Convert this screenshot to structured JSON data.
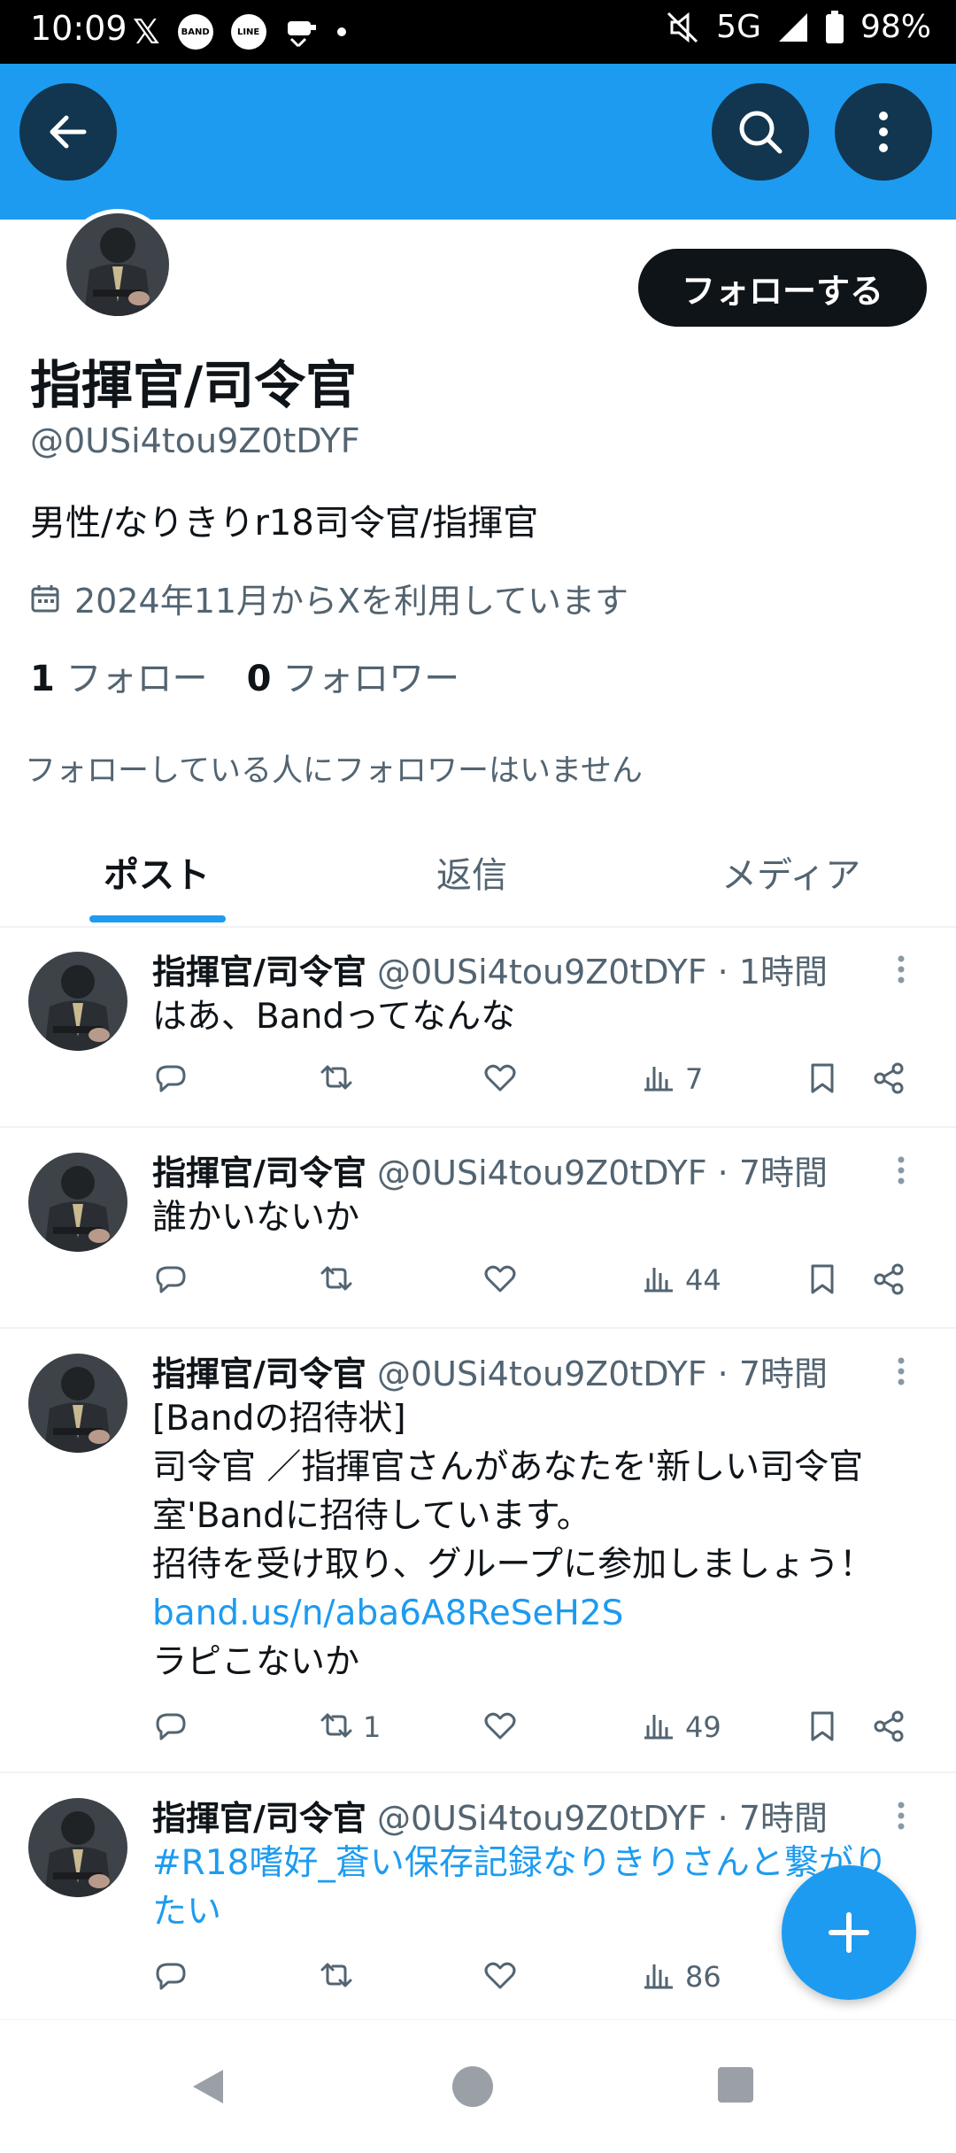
{
  "status_bar": {
    "time": "10:09",
    "network": "5G",
    "battery": "98%",
    "left_icons": [
      "x-icon",
      "band-icon",
      "line-icon",
      "app-icon",
      "dot"
    ],
    "band_label": "BAND",
    "line_label": "LINE"
  },
  "header": {
    "back_icon": "arrow-left-icon",
    "search_icon": "search-icon",
    "more_icon": "more-vertical-icon"
  },
  "profile": {
    "follow_button": "フォローする",
    "display_name": "指揮官/司令官",
    "handle": "@0USi4tou9Z0tDYF",
    "bio": "男性/なりきりr18司令官/指揮官",
    "joined": "2024年11月からXを利用しています",
    "following_count": "1",
    "following_label": "フォロー",
    "followers_count": "0",
    "followers_label": "フォロワー",
    "followers_notice": "フォローしている人にフォロワーはいません"
  },
  "tabs": [
    {
      "label": "ポスト",
      "active": true
    },
    {
      "label": "返信",
      "active": false
    },
    {
      "label": "メディア",
      "active": false
    }
  ],
  "posts": [
    {
      "name": "指揮官/司令官",
      "meta": "@0USi4tou9Z0tDYF · 1時間",
      "lines": [
        "はあ、Bandってなんな"
      ],
      "retweets": "",
      "views": "7"
    },
    {
      "name": "指揮官/司令官",
      "meta": "@0USi4tou9Z0tDYF · 7時間",
      "lines": [
        "誰かいないか"
      ],
      "retweets": "",
      "views": "44"
    },
    {
      "name": "指揮官/司令官",
      "meta": "@0USi4tou9Z0tDYF · 7時間",
      "lines": [
        "[Bandの招待状]",
        "司令官 ／指揮官さんがあなたを'新しい司令官",
        "室'Bandに招待しています。",
        "招待を受け取り、グループに参加しましょう！",
        "band.us/n/aba6A8ReSeH2S",
        "ラピこないか"
      ],
      "link_line": "band.us/n/aba6A8ReSeH2S",
      "retweets": "1",
      "views": "49"
    },
    {
      "name": "指揮官/司令官",
      "meta": "@0USi4tou9Z0tDYF · 7時間",
      "lines": [
        "#R18嗜好_蒼い保存記録なりきりさんと繋がり",
        "たい"
      ],
      "retweets": "",
      "views": "86"
    }
  ],
  "colors": {
    "accent": "#1d9bf0",
    "text_primary": "#0f1419",
    "text_secondary": "#536471",
    "status_bar_bg": "#000000"
  }
}
